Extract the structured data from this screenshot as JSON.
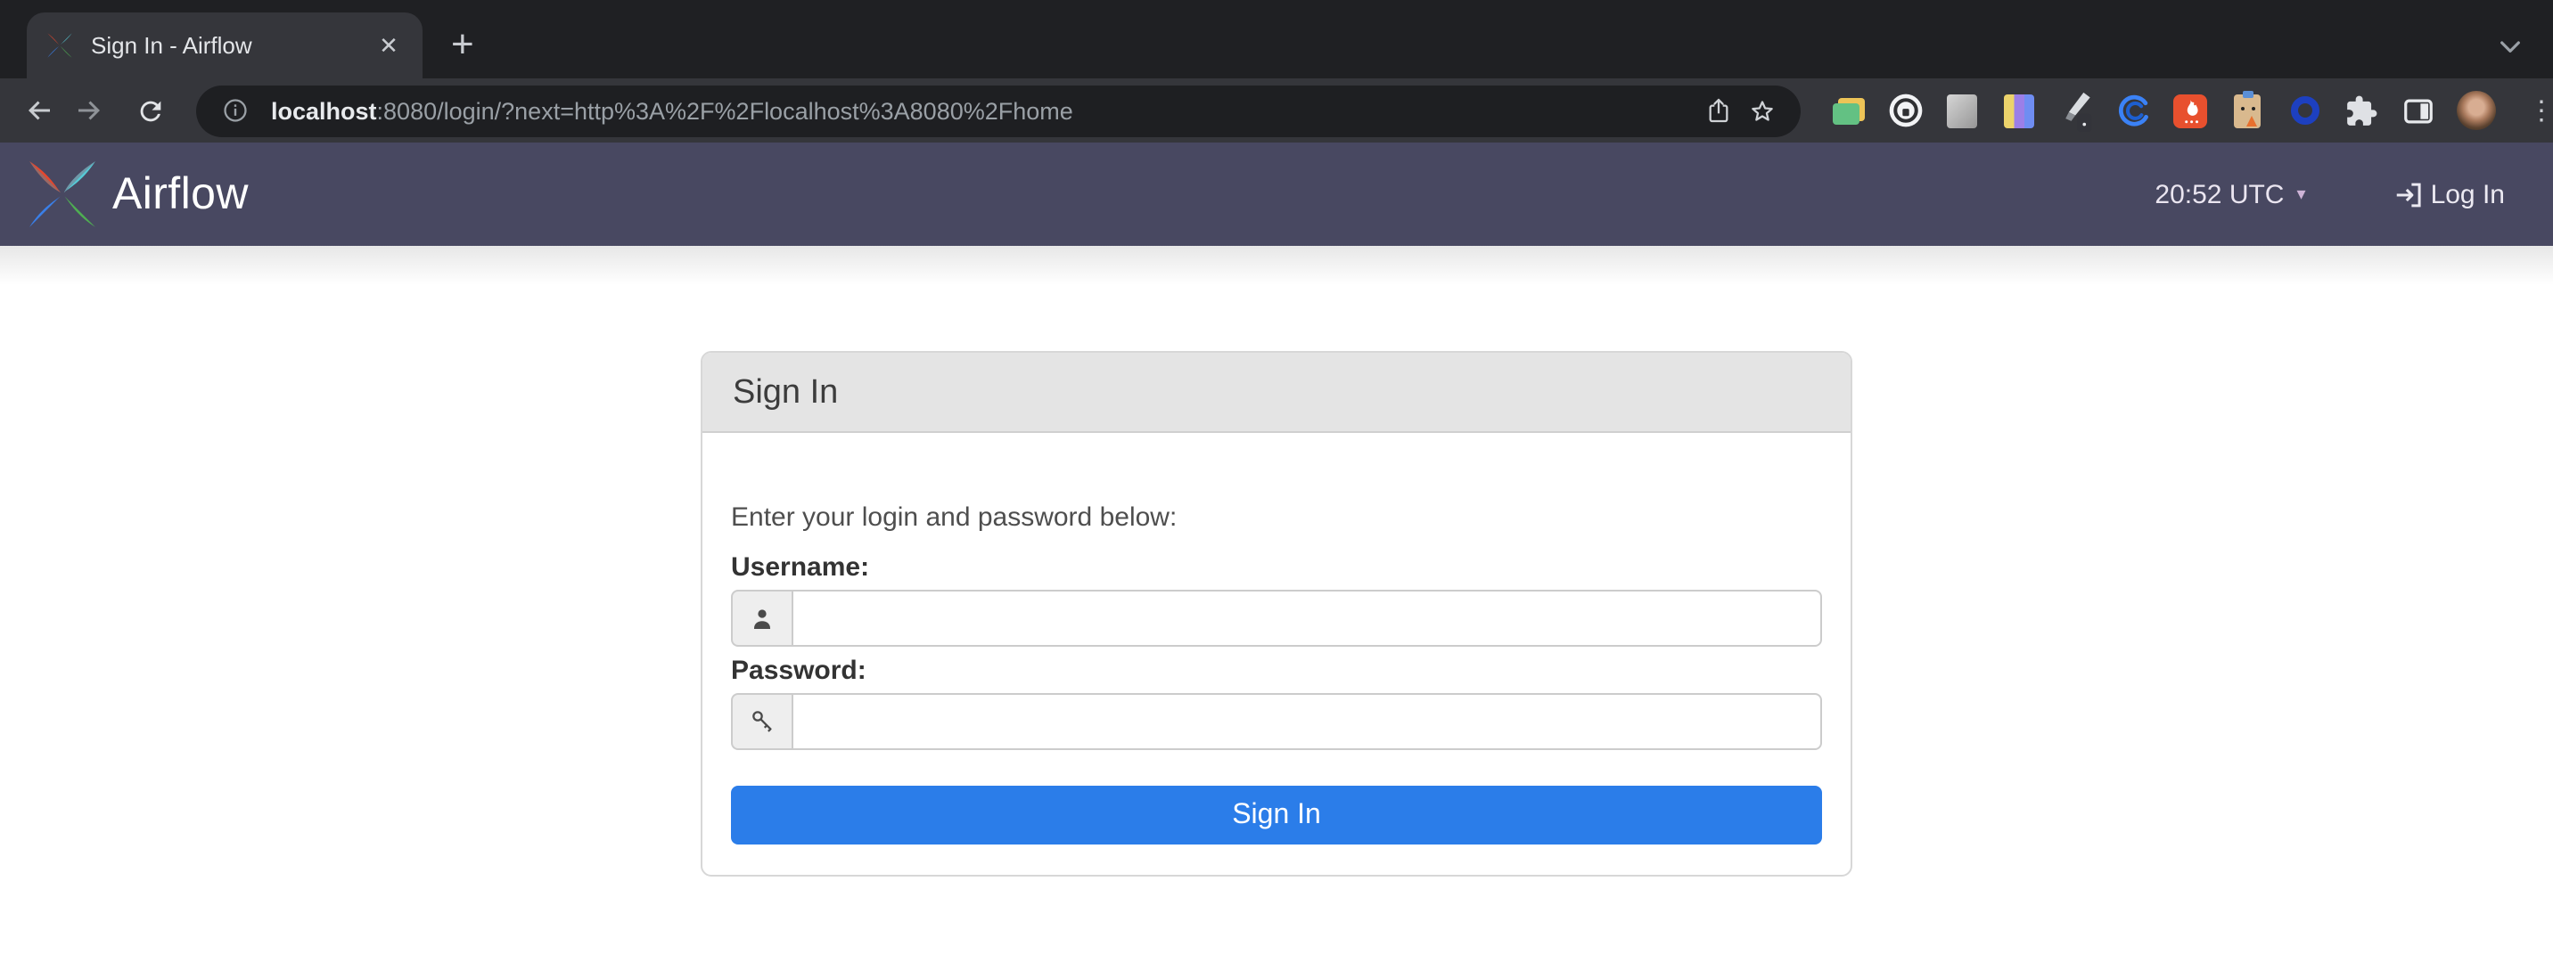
{
  "browser": {
    "tab_title": "Sign In - Airflow",
    "url_host": "localhost",
    "url_rest": ":8080/login/?next=http%3A%2F%2Flocalhost%3A8080%2Fhome",
    "glyphs": {
      "close_tab": "✕",
      "new_tab": "+",
      "overflow_menu": "⋮"
    }
  },
  "navbar": {
    "brand": "Airflow",
    "clock": "20:52 UTC",
    "clock_caret": "▾",
    "login": "Log In"
  },
  "signin": {
    "panel_title": "Sign In",
    "instruction": "Enter your login and password below:",
    "username_label": "Username:",
    "username_value": "",
    "password_label": "Password:",
    "password_value": "",
    "submit": "Sign In"
  },
  "colors": {
    "navbar_bg": "#484861",
    "button_blue": "#2b7de9",
    "chrome_frame": "#1f2023",
    "chrome_toolbar": "#35363b",
    "panel_header_bg": "#e4e4e4"
  }
}
